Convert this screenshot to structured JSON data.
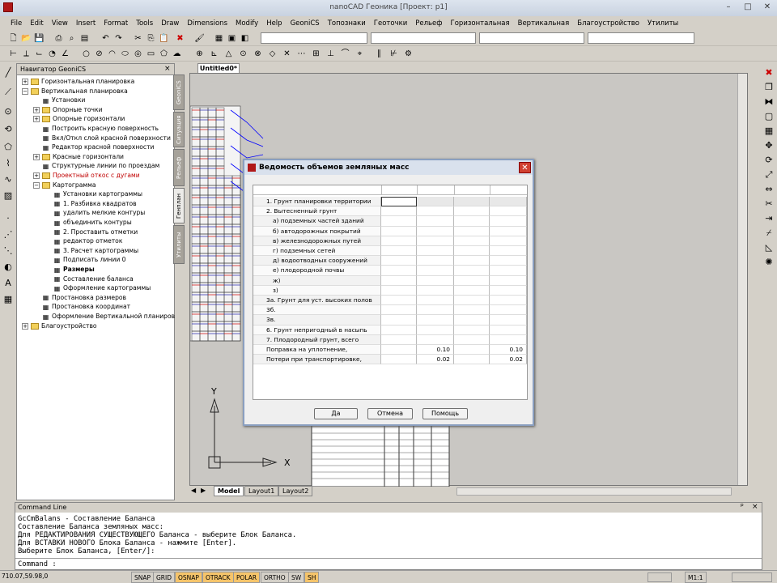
{
  "title": "nanoCAD Геоника [Проект: p1]",
  "menu": [
    "File",
    "Edit",
    "View",
    "Insert",
    "Format",
    "Tools",
    "Draw",
    "Dimensions",
    "Modify",
    "Help",
    "GeoniCS",
    "Топознаки",
    "Геоточки",
    "Рельеф",
    "Горизонтальная",
    "Вертикальная",
    "Благоустройство",
    "Утилиты"
  ],
  "navigator": {
    "title": "Навигатор GeoniCS",
    "items": [
      "Горизонтальная планировка",
      "Вертикальная планировка",
      "Установки",
      "Опорные точки",
      "Опорные горизонтали",
      "Построить красную поверхность",
      "Вкл/Откл слой красной поверхности",
      "Редактор красной поверхности",
      "Красные горизонтали",
      "Структурные линии по проездам",
      "Проектный откос с дугами",
      "Картограмма",
      "Установки картограммы",
      "1. Разбивка квадратов",
      "удалить мелкие контуры",
      "объединить контуры",
      "2. Проставить отметки",
      "редактор отметок",
      "3. Расчет картограммы",
      "Подписать линии 0",
      "Размеры",
      "Составление баланса",
      "Оформление картограммы",
      "Простановка размеров",
      "Простановка координат",
      "Оформление Вертикальной планиров",
      "Благоустройство"
    ]
  },
  "side_tabs": [
    "GeoniCS",
    "Ситуация",
    "Рельеф",
    "Генплан",
    "Утилиты"
  ],
  "doc_tab": "Untitled0*",
  "dialog": {
    "title": "Ведомость объемов земляных масс",
    "rows": [
      {
        "label": "1. Грунт планировки территории",
        "c2": "",
        "c4": ""
      },
      {
        "label": "2. Вытесненный грунт",
        "c2": "",
        "c4": ""
      },
      {
        "label": "а) подземных частей зданий",
        "c2": "",
        "c4": ""
      },
      {
        "label": "б) автодорожных покрытий",
        "c2": "",
        "c4": ""
      },
      {
        "label": "в) железнодорожных путей",
        "c2": "",
        "c4": ""
      },
      {
        "label": "г) подземных сетей",
        "c2": "",
        "c4": ""
      },
      {
        "label": "д) водоотводных сооружений",
        "c2": "",
        "c4": ""
      },
      {
        "label": "е) плодородной почвы",
        "c2": "",
        "c4": ""
      },
      {
        "label": "ж)",
        "c2": "",
        "c4": ""
      },
      {
        "label": "з)",
        "c2": "",
        "c4": ""
      },
      {
        "label": "3а. Грунт для уст. высоких полов",
        "c2": "",
        "c4": ""
      },
      {
        "label": "3б.",
        "c2": "",
        "c4": ""
      },
      {
        "label": "3в.",
        "c2": "",
        "c4": ""
      },
      {
        "label": "6. Грунт непригодный в насыпь",
        "c2": "",
        "c4": ""
      },
      {
        "label": "7. Плодородный грунт, всего",
        "c2": "",
        "c4": ""
      },
      {
        "label": "Поправка на уплотнение,",
        "c2": "0.10",
        "c4": "0.10"
      },
      {
        "label": "Потери при транспортировке,",
        "c2": "0.02",
        "c4": "0.02"
      }
    ],
    "ok": "Да",
    "cancel": "Отмена",
    "help": "Помощь"
  },
  "model_tabs": [
    "Model",
    "Layout1",
    "Layout2"
  ],
  "command": {
    "title": "Command Line",
    "lines": [
      "GcCmBalans - Составление Баланса",
      "Составление Баланса земляных масс:",
      "Для РЕДАКТИРОВАНИЯ СУЩЕСТВУЮЩЕГО Баланса - выберите Блок Баланса.",
      "Для ВСТАВКИ НОВОГО Блока Баланса - нажмите [Enter].",
      "Выберите Блок Баланса, [Enter/]:"
    ],
    "prompt": "Command :"
  },
  "status": {
    "coords": "710.07,59.98,0",
    "buttons": [
      "SNAP",
      "GRID",
      "OSNAP",
      "OTRACK",
      "POLAR",
      "ORTHO",
      "SW",
      "SH"
    ],
    "active": [
      "OSNAP",
      "OTRACK",
      "POLAR",
      "SH"
    ],
    "scale": "M1:1"
  },
  "ucs": {
    "x": "X",
    "y": "Y"
  }
}
